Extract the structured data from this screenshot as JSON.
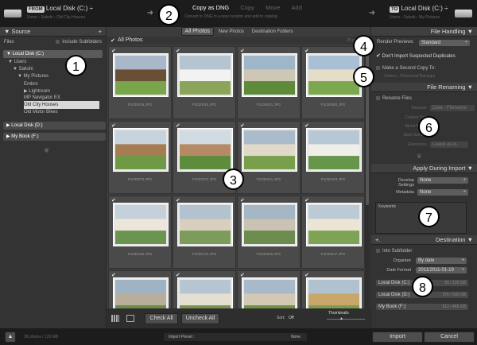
{
  "header": {
    "from_badge": "FROM",
    "from_title": "Local Disk (C:)",
    "from_path": "Users › Sakshi › Old City Houses",
    "mode_active": "Copy as DNG",
    "mode_copy": "Copy",
    "mode_move": "Move",
    "mode_add": "Add",
    "mode_desc": "Convert to DNG in a new location and add to catalog",
    "to_badge": "TO",
    "to_title": "Local Disk (C:)",
    "to_path": "Users › Sakshi › My Pictures"
  },
  "source": {
    "title": "Source",
    "files_label": "Files",
    "include_sub": "Include Subfolders",
    "disk_c": "Local Disk (C:)",
    "tree": [
      "Users",
      "Sakshi",
      "My Pictures",
      "Embro",
      "Lightroom",
      "MP Navigator EX",
      "Old City Houses",
      "Old Motor Bikes"
    ],
    "disk_d": "Local Disk (D:)",
    "mybook": "My Book (F:)"
  },
  "center": {
    "tabs": [
      "All Photos",
      "New Photos",
      "Destination Folders"
    ],
    "all_photos": "All Photos",
    "count": "28 photos",
    "filenames": [
      "P1020016.JPG",
      "P1020015.JPG",
      "P1020041.JPG",
      "P1020060.JPG",
      "P1020070.JPG",
      "P1020072.JPG",
      "P1030101.JPG",
      "P1030103.JPG",
      "P1030155.JPG",
      "P1030170.JPG",
      "P1030260.JPG",
      "P1030247.JPG",
      "",
      "",
      "",
      ""
    ],
    "check_all": "Check All",
    "uncheck_all": "Uncheck All",
    "sort_label": "Sort:",
    "sort_value": "Off",
    "thumbnails": "Thumbnails"
  },
  "right": {
    "file_handling": "File Handling",
    "render_label": "Render Previews",
    "render_value": "Standard",
    "dont_import": "Don't Import Suspected Duplicates",
    "second_copy": "Make a Second Copy To:",
    "second_copy_path": "/Users/.../Download Backups",
    "file_renaming": "File Renaming",
    "rename_files": "Rename Files",
    "template_label": "Template",
    "template_value": "Date - Filename",
    "custom_text": "Custom Text",
    "shoot_name": "Shoot Name",
    "start_number": "Start Number",
    "extensions_label": "Extensions",
    "extensions_value": "Leave as-is",
    "apply_import": "Apply During Import",
    "develop_label": "Develop Settings",
    "develop_value": "None",
    "metadata_label": "Metadata",
    "metadata_value": "None",
    "keywords": "Keywords",
    "destination": "Destination",
    "into_subfolder": "Into Subfolder",
    "organize_label": "Organize",
    "organize_value": "By date",
    "date_format_label": "Date Format",
    "date_format_value": "2011/2011-01-19",
    "disks": [
      {
        "name": "Local Disk (C:)",
        "size": "55 / 120 GB"
      },
      {
        "name": "Local Disk (D:)",
        "size": "276 / 500 GB"
      },
      {
        "name": "My Book (F:)",
        "size": "512 / 465 GB"
      }
    ]
  },
  "footer": {
    "summary": "28 photos / 129 MB",
    "preset_label": "Import Preset :",
    "preset_value": "None",
    "import": "Import",
    "cancel": "Cancel"
  },
  "callouts": [
    "1",
    "2",
    "3",
    "4",
    "5",
    "6",
    "7",
    "8"
  ]
}
